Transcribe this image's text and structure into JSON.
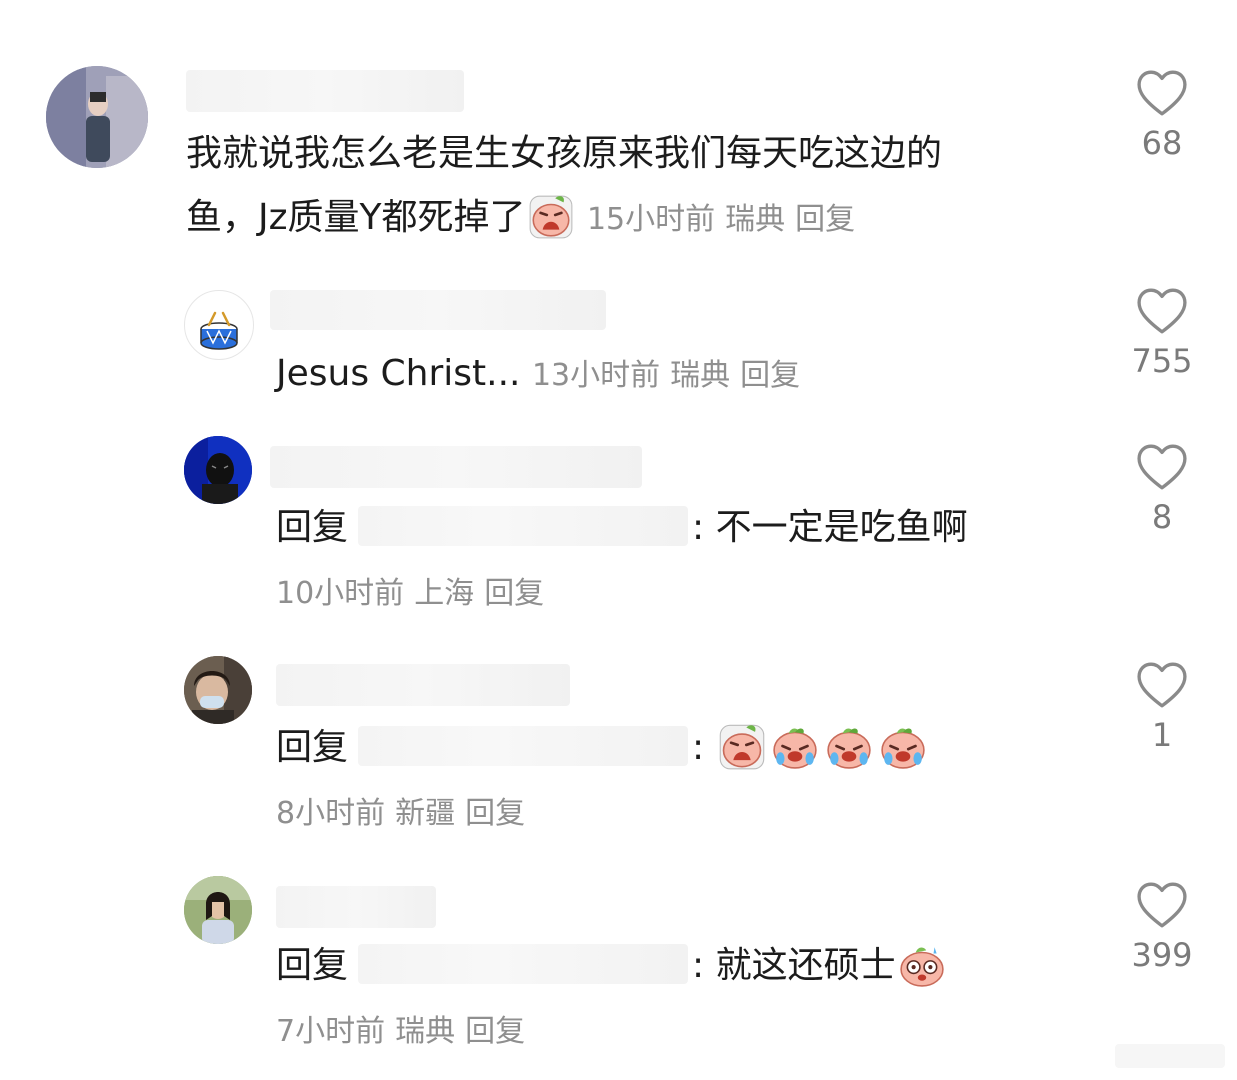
{
  "comments": [
    {
      "line1": "我就说我怎么老是生女孩原来我们每天吃这边的",
      "line2": "鱼，Jz质量Y都死掉了",
      "time": "15小时前",
      "location": "瑞典",
      "reply_label": "回复",
      "likes": "68"
    },
    {
      "text": "Jesus Christ...",
      "time": "13小时前",
      "location": "瑞典",
      "reply_label": "回复",
      "likes": "755"
    },
    {
      "reply_prefix": "回复",
      "colon": ":",
      "text": "不一定是吃鱼啊",
      "time": "10小时前",
      "location": "上海",
      "reply_label": "回复",
      "likes": "8"
    },
    {
      "reply_prefix": "回复",
      "colon": ":",
      "time": "8小时前",
      "location": "新疆",
      "reply_label": "回复",
      "likes": "1"
    },
    {
      "reply_prefix": "回复",
      "colon": ":",
      "text": "就这还硕士",
      "time": "7小时前",
      "location": "瑞典",
      "reply_label": "回复",
      "likes": "399"
    }
  ],
  "icons": {
    "like": "heart-outline-icon",
    "emoji_face": "peach-face-emoji"
  },
  "colors": {
    "text": "#1c1c1c",
    "meta": "#8f8f8f",
    "heart": "#8a8a8a",
    "redaction": "#f3f3f3"
  }
}
